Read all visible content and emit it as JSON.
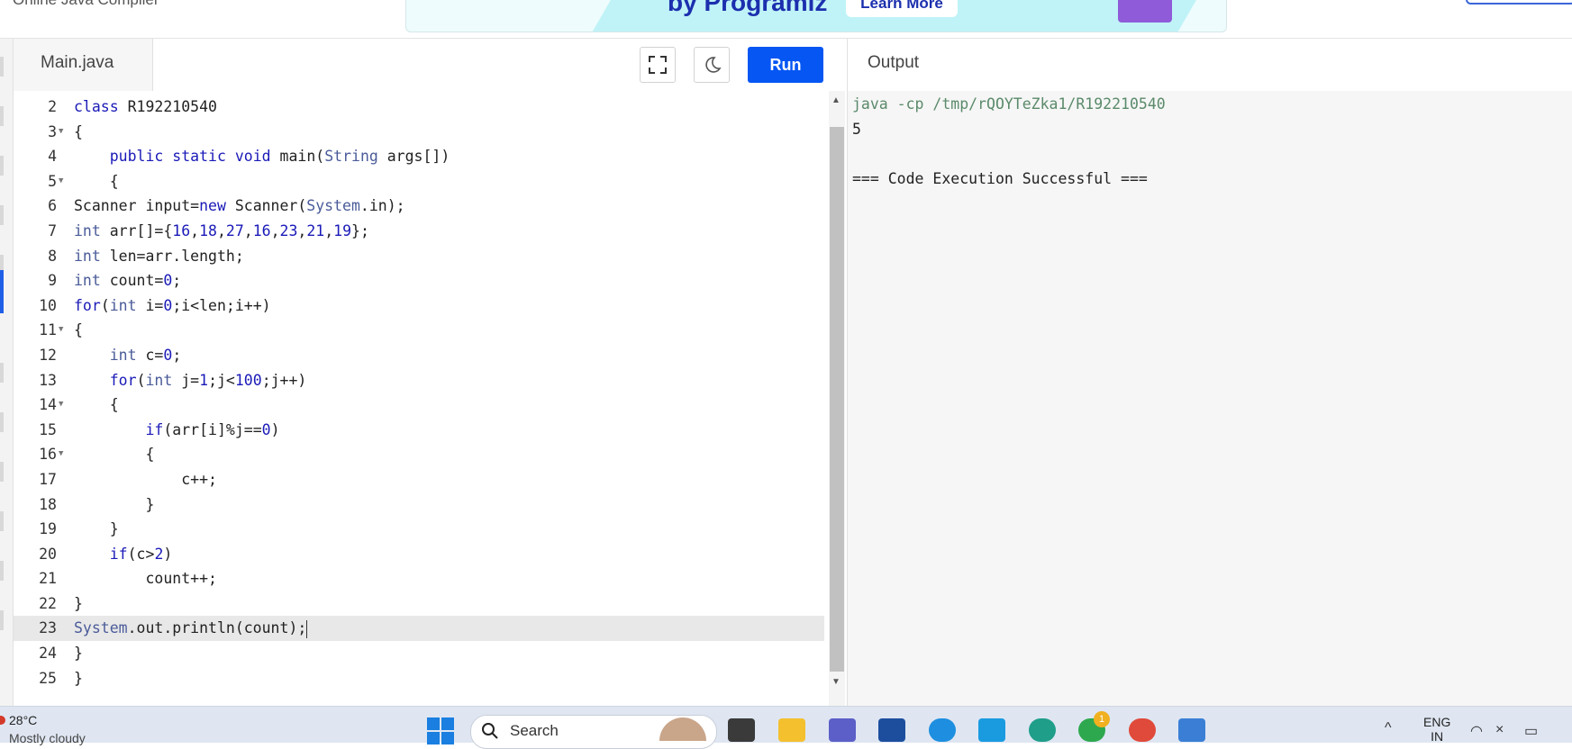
{
  "site": {
    "title": "Online Java Compiler"
  },
  "ad": {
    "headline": "by Programiz",
    "cta": "Learn More"
  },
  "editor": {
    "file_tab": "Main.java",
    "run_label": "Run",
    "lines": [
      {
        "n": "2",
        "text": "class R192210540"
      },
      {
        "n": "3",
        "text": "{"
      },
      {
        "n": "4",
        "text": "    public static void main(String args[])"
      },
      {
        "n": "5",
        "text": "    {"
      },
      {
        "n": "6",
        "text": "Scanner input=new Scanner(System.in);"
      },
      {
        "n": "7",
        "text": "int arr[]={16,18,27,16,23,21,19};"
      },
      {
        "n": "8",
        "text": "int len=arr.length;"
      },
      {
        "n": "9",
        "text": "int count=0;"
      },
      {
        "n": "10",
        "text": "for(int i=0;i<len;i++)"
      },
      {
        "n": "11",
        "text": "{"
      },
      {
        "n": "12",
        "text": "    int c=0;"
      },
      {
        "n": "13",
        "text": "    for(int j=1;j<100;j++)"
      },
      {
        "n": "14",
        "text": "    {"
      },
      {
        "n": "15",
        "text": "        if(arr[i]%j==0)"
      },
      {
        "n": "16",
        "text": "        {"
      },
      {
        "n": "17",
        "text": "            c++;"
      },
      {
        "n": "18",
        "text": "        }"
      },
      {
        "n": "19",
        "text": "    }"
      },
      {
        "n": "20",
        "text": "    if(c>2)"
      },
      {
        "n": "21",
        "text": "        count++;"
      },
      {
        "n": "22",
        "text": "}"
      },
      {
        "n": "23",
        "text": "System.out.println(count);"
      },
      {
        "n": "24",
        "text": "}"
      },
      {
        "n": "25",
        "text": "}"
      }
    ]
  },
  "output": {
    "label": "Output",
    "command": "java -cp /tmp/rQOYTeZka1/R192210540",
    "result": "5",
    "status": "=== Code Execution Successful ==="
  },
  "taskbar": {
    "weather_temp": "28°C",
    "weather_desc": "Mostly cloudy",
    "search_label": "Search",
    "lang_top": "ENG",
    "lang_bottom": "IN",
    "whatsapp_badge": "1"
  }
}
